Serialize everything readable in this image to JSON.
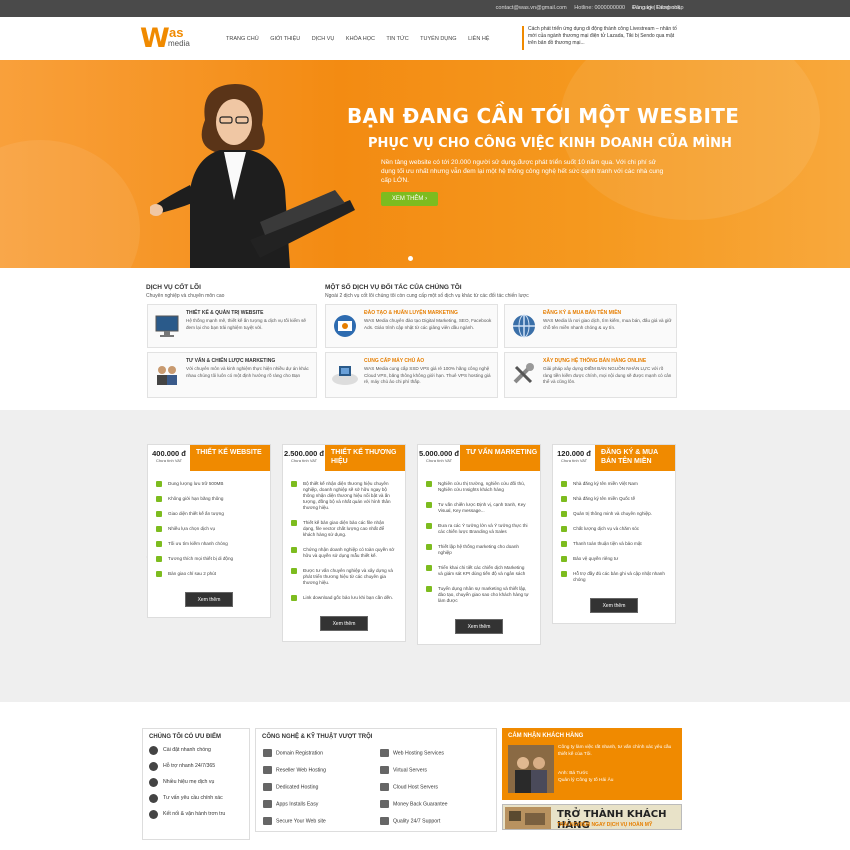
{
  "topbar": {
    "email": "contact@was.vn@gmail.com",
    "hotline": "Hotline: 0000000000",
    "fanpage": "Fanpage Facebook",
    "login": "Đăng ký | Đăng nhập"
  },
  "logo": {
    "w": "W",
    "as": "as",
    "media": "media"
  },
  "nav": [
    "TRANG CHỦ",
    "GIỚI THIỆU",
    "DỊCH VỤ",
    "KHÓA HỌC",
    "TIN TỨC",
    "TUYỂN DỤNG",
    "LIÊN HỆ"
  ],
  "marquee": "Cách phát triển ứng dụng di động thành công Livestream – nhân tố mới của ngành thương mại điện tử Lazada, Tiki bị Sendo qua mặt trên bản đồ thương mại...",
  "hero": {
    "title": "BẠN ĐANG CẦN TỚI MỘT WESBITE",
    "subtitle": "PHỤC VỤ CHO CÔNG VIỆC KINH DOANH CỦA MÌNH",
    "desc": "Nền tảng website có tới 20.000 người sử dụng,được phát triển suốt 10 năm qua. Với chi phí sử dụng tối ưu nhất nhưng vẫn đem lại một hệ thống công nghệ hết sức cạnh tranh với các nhà cung cấp LỚN.",
    "button": "XEM THÊM ›"
  },
  "core": {
    "title": "DỊCH VỤ CỐT LÕI",
    "subtitle": "Chuyên nghiệp và chuyên môn cao",
    "items": [
      {
        "title": "THIẾT KẾ & QUẢN TRỊ WEBSITE",
        "desc": "Hệ thống mạnh mẽ, thiết kế ấn tượng & dịch vụ tối kiểm sẽ đem lại cho bạn trải nghiệm tuyệt vời."
      },
      {
        "title": "TƯ VẤN & CHIẾN LƯỢC MARKETING",
        "desc": "Với chuyên môn và kinh nghiệm thực hiện nhiều dự án khác nhau chúng tôi luôn có một định hướng rõ ràng cho Bạn"
      }
    ]
  },
  "partner": {
    "title": "MỘT SỐ DỊCH VỤ ĐỐI TÁC CỦA CHÚNG TÔI",
    "subtitle": "Ngoài 2 dịch vụ cốt lõi chúng tôi còn cung cấp một số dịch vụ khác từ các đối tác chiến lược",
    "items": [
      {
        "title": "ĐÀO TẠO & HUẤN LUYỆN MARKETING",
        "desc": "WAS Media chuyên đào tạo Digital Marketing, SEO, Facebook Ads. Giáo trình cập nhật từ các giảng viên dầu ngành."
      },
      {
        "title": "ĐĂNG KÝ & MUA BÁN TÊN MIỀN",
        "desc": "WAS Media là nơi giao dịch, tìm kiếm, mua bán, đấu giá và giữ chỗ tên miền nhanh chóng & uy tín."
      },
      {
        "title": "CUNG CẤP MÁY CHỦ ẢO",
        "desc": "WAS Media cung cấp SSD VPS giá rẻ 100% hãng công nghệ Cloud VPS, băng thông không giới hạn. Thuê VPS hosting giá rẻ, máy chủ ảo chi phí thấp."
      },
      {
        "title": "XÂY DỰNG HỆ THỐNG BÁN HÀNG ONLINE",
        "desc": "Giải pháp xây dựng ĐIỀM BÁN NGUỒN NHÂN LỰC với rõ ràng tiền kiếm được chính, mọi nội dung sẽ được mạnh có cân thể và cũng lôn."
      }
    ]
  },
  "pricing": [
    {
      "price": "400.000 đ",
      "unit": "Chưa tính VAT",
      "name": "THIẾT KẾ WEBSITE",
      "button": "Xem thêm",
      "features": [
        "Dung lượng lưu trữ 500MB",
        "Không giới hạn băng thông",
        "Giao diện thiết kế ấn tượng",
        "Nhiều lựa chọn dịch vụ",
        "Tối ưu tìm kiếm nhanh chóng",
        "Tương thích mọi thiết bị di động",
        "Bàn giao chỉ sau 2 phút"
      ]
    },
    {
      "price": "2.500.000 đ",
      "unit": "Chưa tính VAT",
      "name": "THIẾT KẾ THƯƠNG HIỆU",
      "button": "Xem thêm",
      "features": [
        "Bộ thiết kế nhận diện thương hiệu chuyên nghiệp, doanh nghiệp sẽ sở hữu ngay bộ thông nhận diện thương hiệu nổi bật và ấn tượng, đồng bộ và nhất quán với hình thân thương hiệu.",
        "Thiết kế bản giao diện bảo các file nhận dạng, file vector chất lượng cao nhất để khách hàng sử dụng.",
        "Chứng nhận doanh nghiệp có toàn quyền sở hữu và quyền sử dụng mẫu thiết kế.",
        "Được tư vấn chuyên nghiệp và xây dựng và phát triển thương hiệu từ các chuyên gia thương hiệu.",
        "Link download gốc bảo lưu khi bạn cần dến."
      ]
    },
    {
      "price": "5.000.000 đ",
      "unit": "Chưa tính VAT",
      "name": "TƯ VẤN MARKETING",
      "button": "Xem thêm",
      "features": [
        "Nghiên cứu thị trường, nghiên cứu đối thủ, Nghiên cứu Insights khách hàng",
        "Tư vấn chiến lược Định vị, cạnh tranh, Key Visual, Key message...",
        "Đưa ra các Ý tưởng lớn và Ý tưởng thực thi các chiến lược Branding và Sales",
        "Thiết lập hệ thống marketing cho doanh nghiệp",
        "Triển khai chi tiết các chiến dịch Marketing và giám sát KPI dùng tiến độ và ngân sách",
        "Tuyển dụng nhân sự marketing và thiết lập, đào tạo, chuyển giao sao cho khách hàng tự làm được"
      ]
    },
    {
      "price": "120.000 đ",
      "unit": "Chưa tính VAT",
      "name": "ĐĂNG KÝ & MUA BÁN TÊN MIỀN",
      "button": "Xem thêm",
      "features": [
        "Nhà đăng ký tên miền Việt Nam",
        "Nhà đăng ký tên miền Quốc tế",
        "Quản trị thông minh và chuyên nghiệp.",
        "Chất lượng dịch vụ và chăm sóc",
        "Thanh toán thuận tiện và bảo mật",
        "Bảo vệ quyền riêng tư",
        "Hỗ trợ đầy đủ các bản ghi và cập nhật nhanh chóng"
      ]
    }
  ],
  "advantages": {
    "title": "CHÚNG TÔI CÓ ƯU ĐIỂM",
    "items": [
      "Cài đặt nhanh chóng",
      "Hỗ trợ nhanh 24/7/365",
      "Nhiều hiệu mẹ dịch vụ",
      "Tư vấn yêu cầu chính xác",
      "Kết nối & vận hành trơn tru"
    ]
  },
  "tech": {
    "title": "CÔNG NGHỆ & KỸ THUẬT VƯỢT TRỘI",
    "left": [
      "Domain Registration",
      "Reseller Web Hosting",
      "Dedicated Hosting",
      "Apps Installs Easy",
      "Secure Your Web site"
    ],
    "right": [
      "Web Hosting Services",
      "Virtual Servers",
      "Cloud Host Servers",
      "Money Back Guarantee",
      "Quality 24/7 Support"
    ]
  },
  "testimonial": {
    "title": "CẢM NHẬN KHÁCH HÀNG",
    "quote": "Công ty làm việc rất nhanh, tư vấn chính xác yêu cầu thiết kế của Tôi.",
    "author": "Anh: Bá Tước",
    "company": "Quản lý Công ty tố Hải Âu"
  },
  "cta": {
    "title": "TRỞ THÀNH KHÁCH HÀNG",
    "sub": "TRẢI NGHIỆM NGAY DỊCH VỤ HOÀN MỸ"
  },
  "colors": {
    "accent": "#f08a00",
    "green": "#7dbc1f",
    "topbar": "#4a4a4a"
  }
}
